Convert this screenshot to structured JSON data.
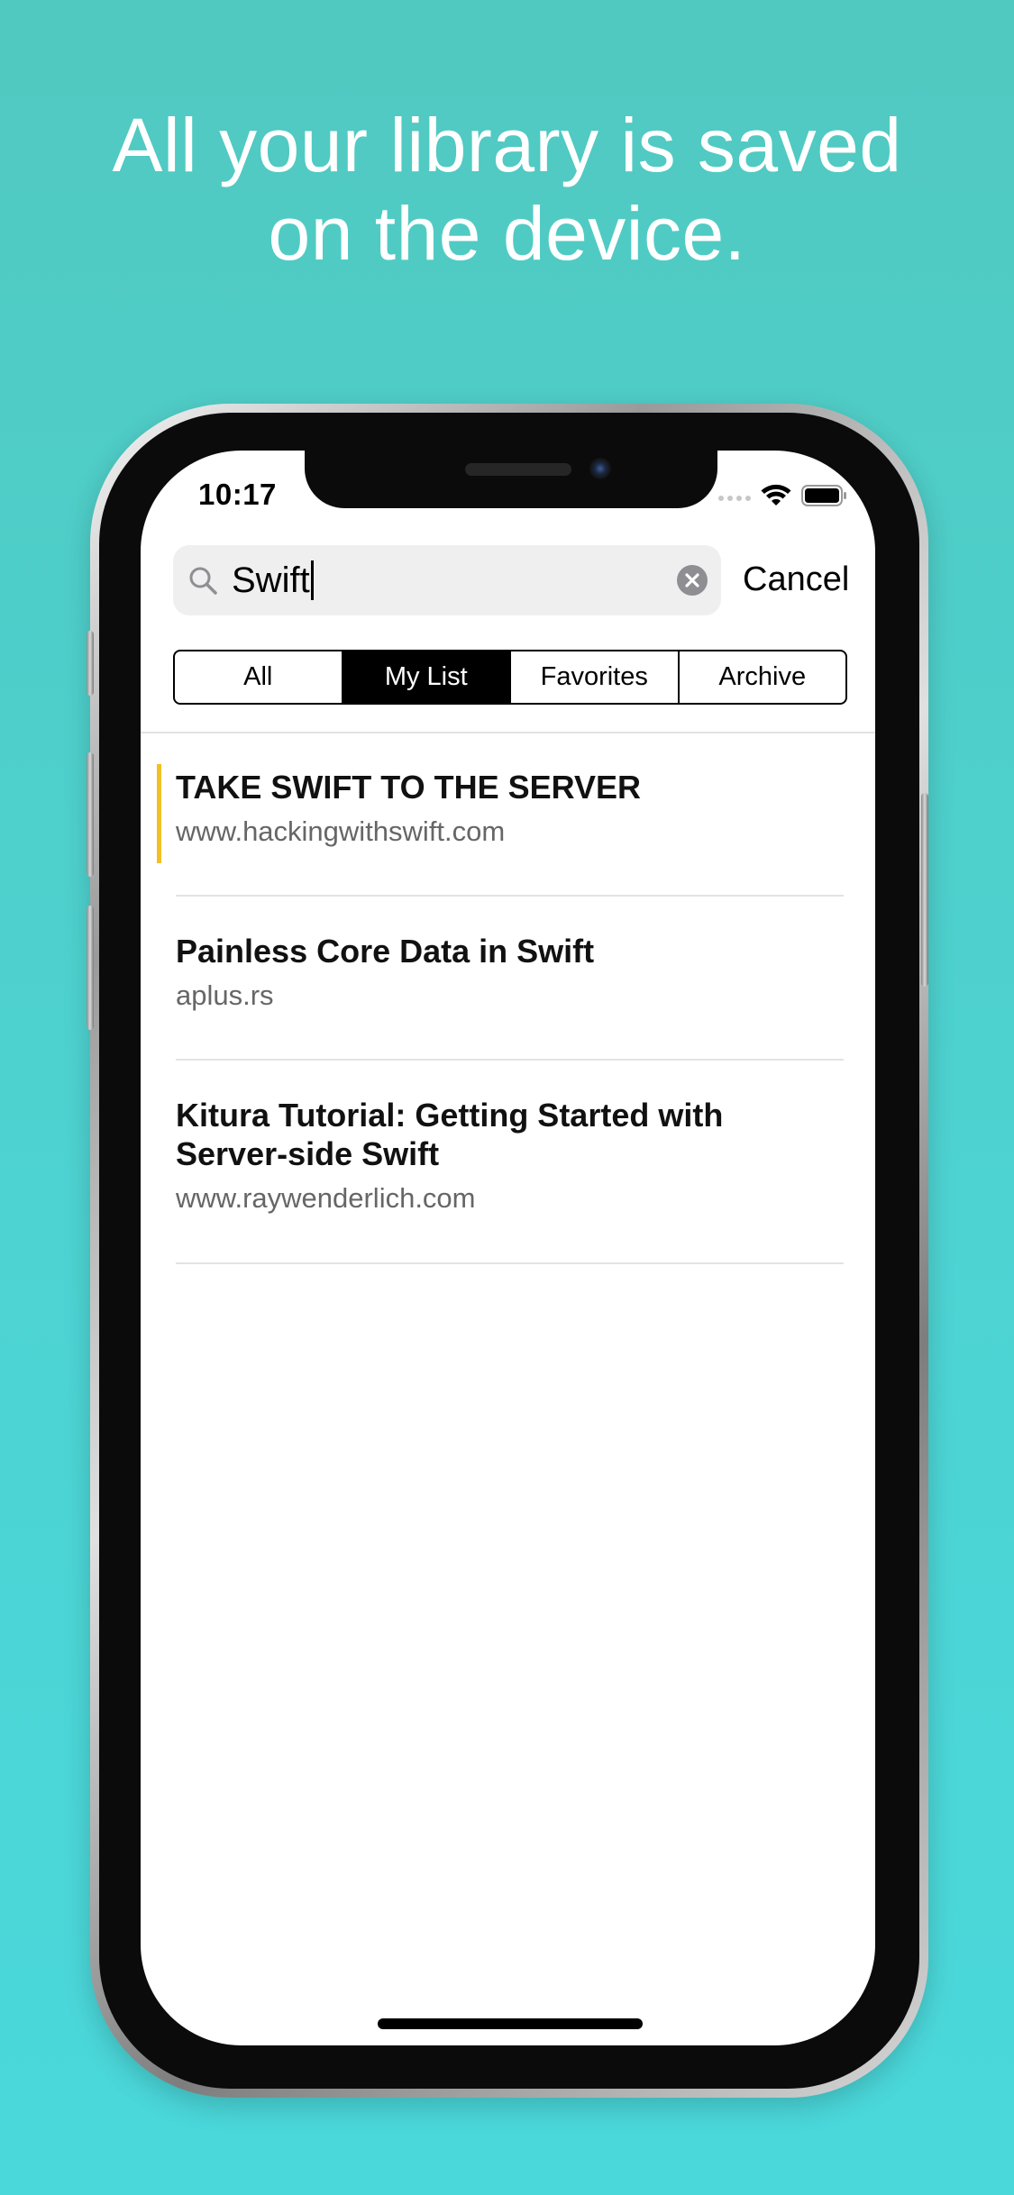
{
  "headline": {
    "line1": "All your library is saved",
    "line2": "on the device."
  },
  "status_bar": {
    "time": "10:17",
    "icons": [
      "cellular-signal-icon",
      "wifi-icon",
      "battery-icon"
    ]
  },
  "search": {
    "value": "Swift",
    "cancel_label": "Cancel"
  },
  "segments": [
    {
      "label": "All",
      "active": false
    },
    {
      "label": "My List",
      "active": true
    },
    {
      "label": "Favorites",
      "active": false
    },
    {
      "label": "Archive",
      "active": false
    }
  ],
  "items": [
    {
      "title": "TAKE SWIFT TO THE SERVER",
      "domain": "www.hackingwithswift.com",
      "highlighted": true
    },
    {
      "title": "Painless Core Data in Swift",
      "domain": "aplus.rs",
      "highlighted": false
    },
    {
      "title": "Kitura Tutorial: Getting Started with Server-side Swift",
      "domain": "www.raywenderlich.com",
      "highlighted": false
    }
  ],
  "colors": {
    "background": "#4fcfc9",
    "highlight": "#f2c024",
    "segment_active": "#000000",
    "text_secondary": "#666666"
  }
}
